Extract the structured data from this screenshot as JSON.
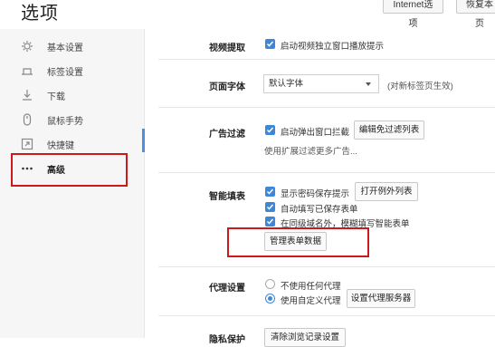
{
  "title": "选项",
  "top_buttons": {
    "internet": "Internet选项",
    "restore": "恢复本页"
  },
  "sidebar": {
    "items": [
      {
        "label": "基本设置",
        "icon": "gear-icon"
      },
      {
        "label": "标签设置",
        "icon": "tab-icon"
      },
      {
        "label": "下载",
        "icon": "download-icon"
      },
      {
        "label": "鼠标手势",
        "icon": "mouse-icon"
      },
      {
        "label": "快捷键",
        "icon": "shortcut-icon"
      },
      {
        "label": "高级",
        "icon": "more-icon",
        "active": true
      }
    ]
  },
  "sections": {
    "video": {
      "label": "视频提取",
      "option": "启动视频独立窗口播放提示"
    },
    "font": {
      "label": "页面字体",
      "select_value": "默认字体",
      "note": "(对新标签页生效)"
    },
    "ad": {
      "label": "广告过滤",
      "option": "启动弹出窗口拦截",
      "button": "编辑免过滤列表",
      "hint": "使用扩展过滤更多广告..."
    },
    "autofill": {
      "label": "智能填表",
      "options": [
        "显示密码保存提示",
        "自动填写已保存表单",
        "在同级域名外，模糊填写智能表单"
      ],
      "exception_button": "打开例外列表",
      "manage_button": "管理表单数据"
    },
    "proxy": {
      "label": "代理设置",
      "options": [
        "不使用任何代理",
        "使用自定义代理"
      ],
      "button": "设置代理服务器"
    },
    "privacy": {
      "label": "隐私保护",
      "button": "清除浏览记录设置"
    }
  },
  "colors": {
    "accent": "#3d86d8",
    "highlight": "#cc1a1a"
  }
}
